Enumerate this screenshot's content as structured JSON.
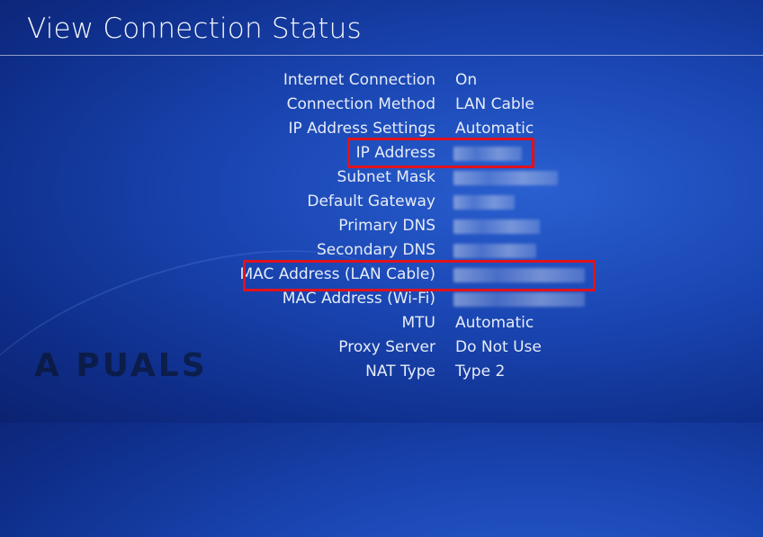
{
  "header": {
    "title": "View Connection Status"
  },
  "rows": [
    {
      "label": "Internet Connection",
      "value": "On"
    },
    {
      "label": "Connection Method",
      "value": "LAN Cable"
    },
    {
      "label": "IP Address Settings",
      "value": "Automatic"
    },
    {
      "label": "IP Address",
      "value": ""
    },
    {
      "label": "Subnet Mask",
      "value": ""
    },
    {
      "label": "Default Gateway",
      "value": ""
    },
    {
      "label": "Primary DNS",
      "value": ""
    },
    {
      "label": "Secondary DNS",
      "value": ""
    },
    {
      "label": "MAC Address (LAN Cable)",
      "value": ""
    },
    {
      "label": "MAC Address (Wi-Fi)",
      "value": ""
    },
    {
      "label": "MTU",
      "value": "Automatic"
    },
    {
      "label": "Proxy Server",
      "value": "Do Not Use"
    },
    {
      "label": "NAT Type",
      "value": "Type 2"
    }
  ],
  "watermark": {
    "text": "A PUALS"
  },
  "colors": {
    "highlight": "#e0121c",
    "background": "#1a46b3"
  }
}
